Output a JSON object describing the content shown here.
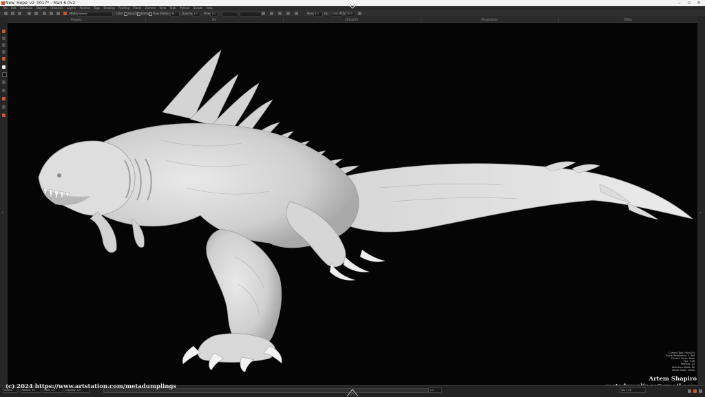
{
  "window": {
    "title": "New_Hope_v2_0017* - Mari 6.0v2"
  },
  "menu": [
    "File",
    "Edit",
    "Selection",
    "Objects",
    "Channels",
    "Layers",
    "Patches",
    "Tags",
    "Shading",
    "Painting",
    "Filters",
    "Camera",
    "View",
    "Tools",
    "Python",
    "Scripts",
    "Help"
  ],
  "tool_options": {
    "mode_label": "Mode",
    "mode_value": "Normal",
    "color_label": "Color",
    "opacity_toggle": "Opacity",
    "radius_toggle": "Radius",
    "flow_toggle": "Flow",
    "radius_label": "Radius",
    "radius_value": "34",
    "opacity_label": "Opacity",
    "opacity_value": "1.0",
    "flow_label": "Flow",
    "flow_value": "1.0",
    "near_label": "Near",
    "near_value": "0.0",
    "far_label": "Far",
    "far_value": "1,000.0",
    "fov_label": "FOV",
    "fov_value": "30.0"
  },
  "panels": [
    "Projects",
    "UV",
    "Ortho/UV",
    "Perspective",
    "Ortho"
  ],
  "hud": [
    "Current Tool: Paint (P)",
    "Brush Resolution: 1,000",
    "Current Layer: base",
    "Fps: 7.46",
    "Patches: 24",
    "Selection Mode: All",
    "Brush Color: 100%"
  ],
  "status": {
    "left_label": "Status",
    "radius": "Radius: 34",
    "flow": "Flow: 1.0",
    "opacity": "Opacity: 1.0",
    "frame_label": "Frame",
    "frame_value": "1/1",
    "zoom_value": "1.0",
    "fps_label": "Fps",
    "fps_value": "7.46"
  },
  "watermark": "(c) 2024 https://www.artstation.com/metadumplings",
  "author": {
    "name": "Artem Shapiro",
    "email": "metadumplings@gmail.com"
  },
  "colors": {
    "accent": "#c65b2a",
    "viewport_bg": "#050505",
    "model": "#d9d9d9"
  }
}
